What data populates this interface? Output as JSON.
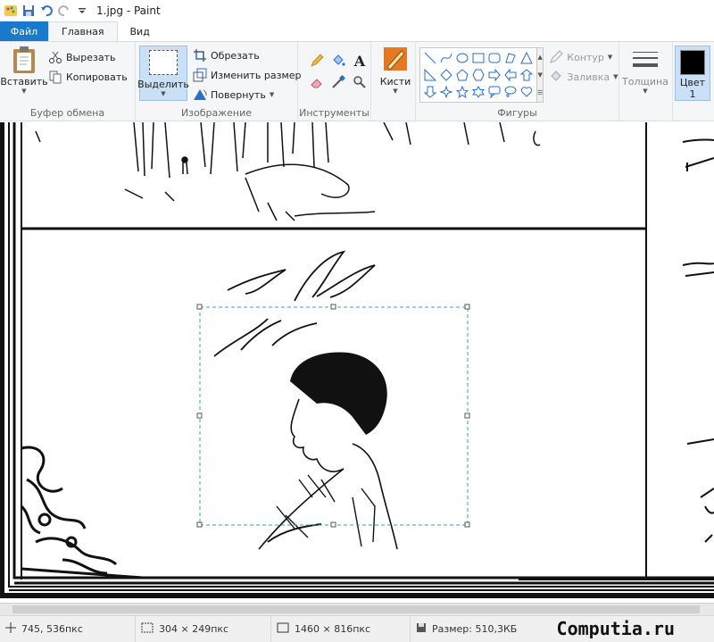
{
  "window": {
    "title": "1.jpg - Paint"
  },
  "tabs": {
    "file": "Файл",
    "home": "Главная",
    "view": "Вид"
  },
  "ribbon": {
    "clipboard": {
      "paste": "Вставить",
      "cut": "Вырезать",
      "copy": "Копировать",
      "label": "Буфер обмена"
    },
    "image": {
      "select": "Выделить",
      "crop": "Обрезать",
      "resize": "Изменить размер",
      "rotate": "Повернуть",
      "label": "Изображение"
    },
    "tools": {
      "label": "Инструменты"
    },
    "brushes": {
      "label": "Кисти"
    },
    "shapes": {
      "outline": "Контур",
      "fill": "Заливка",
      "label": "Фигуры"
    },
    "size": {
      "label": "Толщина"
    },
    "color": {
      "label": "Цвет",
      "index": "1",
      "value": "#000000"
    }
  },
  "status": {
    "cursor": "745, 536пкс",
    "selection": "304 × 249пкс",
    "image_size": "1460 × 816пкс",
    "file_size": "Размер: 510,3КБ"
  },
  "watermark": "Computia.ru",
  "colors": {
    "accent": "#1979ca",
    "ribbon_bg": "#f5f6f7",
    "selection": "#c9e0f7"
  }
}
